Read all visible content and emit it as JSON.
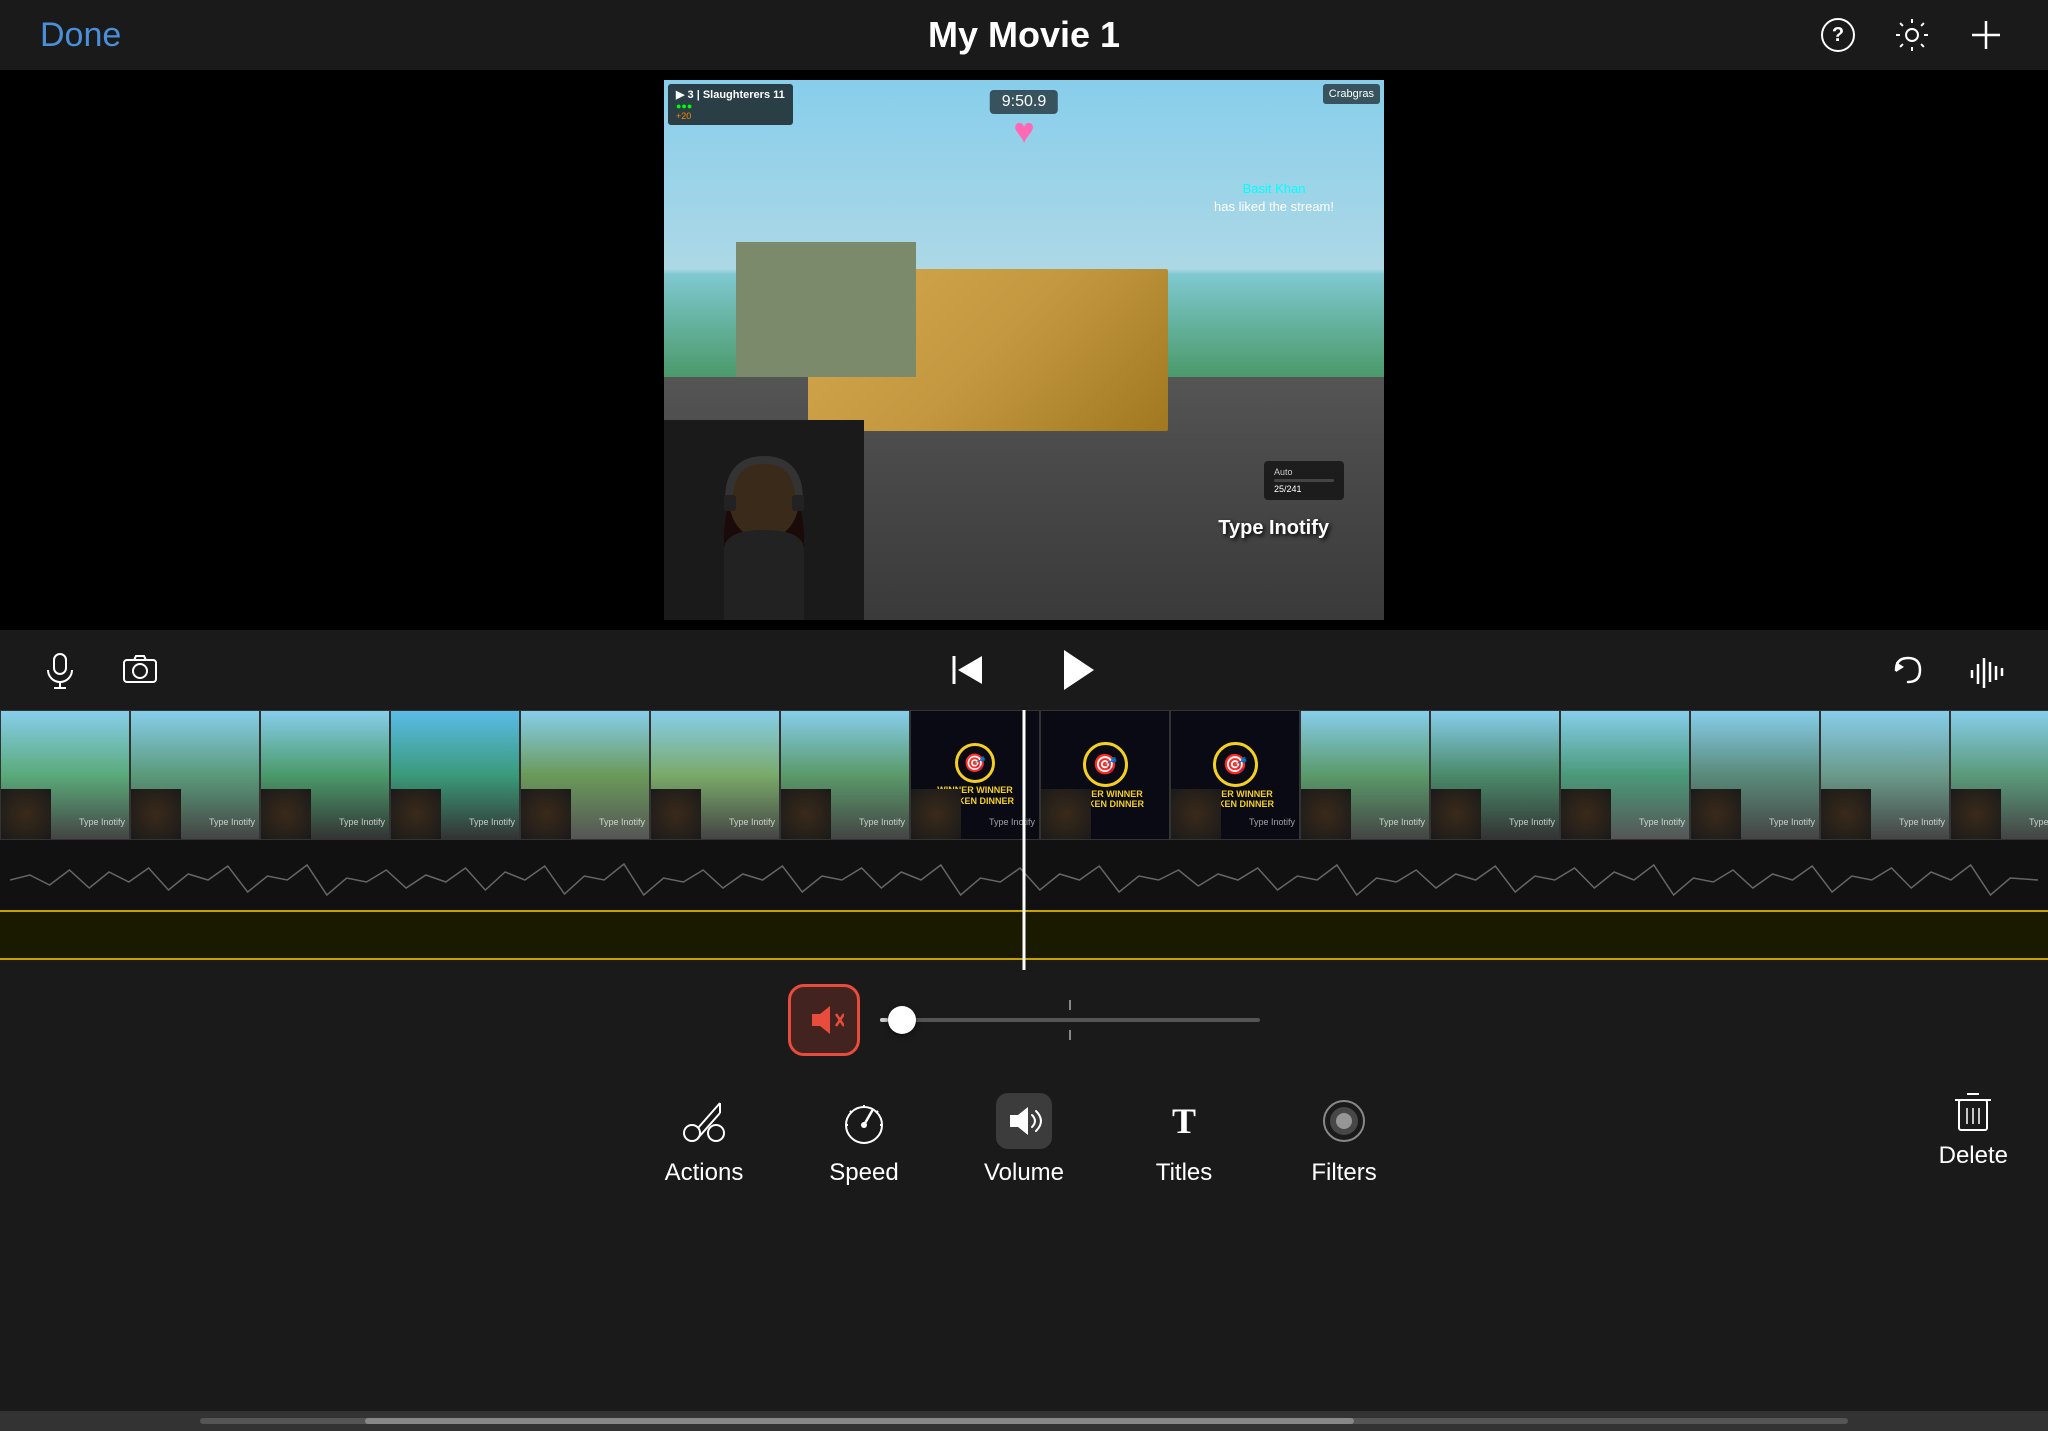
{
  "header": {
    "done_label": "Done",
    "title": "My Movie 1",
    "help_icon": "help-icon",
    "settings_icon": "settings-icon",
    "add_icon": "add-icon"
  },
  "preview": {
    "timestamp": "9:50.9",
    "like_notification": "has liked the stream!",
    "like_user": "Basit Khan",
    "type_label": "Type Inotify",
    "crabgrass_label": "Crabgras"
  },
  "playback": {
    "rewind_icon": "rewind-to-start-icon",
    "play_icon": "play-icon",
    "microphone_icon": "microphone-icon",
    "camera_icon": "camera-icon",
    "undo_icon": "undo-icon",
    "waveform_icon": "waveform-icon"
  },
  "volume": {
    "mute_icon": "mute-icon",
    "slider_value": 8,
    "slider_max": 100,
    "tick_label": ""
  },
  "toolbar": {
    "items": [
      {
        "id": "actions",
        "label": "Actions",
        "icon": "scissors-icon"
      },
      {
        "id": "speed",
        "label": "Speed",
        "icon": "speed-icon"
      },
      {
        "id": "volume",
        "label": "Volume",
        "icon": "volume-icon",
        "active": true
      },
      {
        "id": "titles",
        "label": "Titles",
        "icon": "titles-icon"
      },
      {
        "id": "filters",
        "label": "Filters",
        "icon": "filters-icon"
      }
    ],
    "delete_label": "Delete"
  },
  "timeline": {
    "thumbnails_count": 16,
    "playhead_position": "50%"
  }
}
